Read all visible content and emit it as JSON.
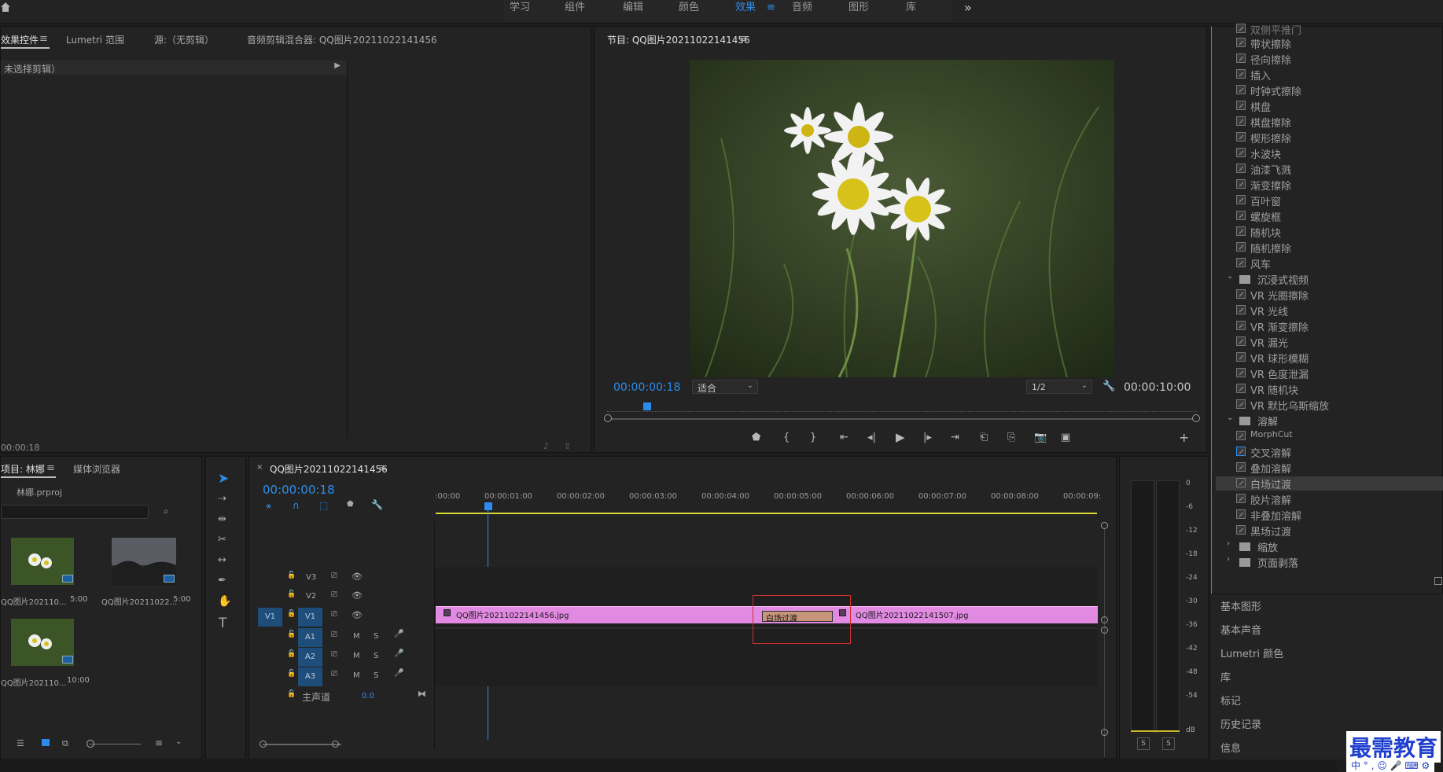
{
  "workspace_tabs": [
    "学习",
    "组件",
    "编辑",
    "颜色",
    "效果",
    "音频",
    "图形",
    "库"
  ],
  "more_symbol": "»",
  "home_icon": "home-icon",
  "effect_controls": {
    "tabs": [
      "效果控件",
      "Lumetri 范围",
      "源:（无剪辑）",
      "音频剪辑混合器: QQ图片20211022141456"
    ],
    "no_clip": "未选择剪辑）",
    "timecode": "00:00:18"
  },
  "program": {
    "title": "节目: QQ图片20211022141456",
    "timecode": "00:00:00:18",
    "fit": "适合",
    "resolution": "1/2",
    "duration": "00:00:10:00"
  },
  "project": {
    "tabs": [
      "项目: 林娜",
      "媒体浏览器"
    ],
    "file": "林娜.prproj",
    "items": [
      {
        "name": "QQ图片202110...",
        "duration": "5:00"
      },
      {
        "name": "QQ图片20211022...",
        "duration": "5:00"
      },
      {
        "name": "QQ图片202110...",
        "duration": "10:00"
      }
    ]
  },
  "timeline": {
    "title": "QQ图片20211022141456",
    "timecode": "00:00:00:18",
    "ruler": [
      ":00:00",
      "00:00:01:00",
      "00:00:02:00",
      "00:00:03:00",
      "00:00:04:00",
      "00:00:05:00",
      "00:00:06:00",
      "00:00:07:00",
      "00:00:08:00",
      "00:00:09:"
    ],
    "video_tracks": [
      "V3",
      "V2",
      "V1"
    ],
    "audio_tracks": [
      "A1",
      "A2",
      "A3"
    ],
    "source_patch": "V1",
    "master_label": "主声道",
    "master_value": "0.0",
    "clip1": "QQ图片20211022141456.jpg",
    "clip2": "QQ图片20211022141507.jpg",
    "transition": "白场过渡",
    "track_m": "M",
    "track_s": "S"
  },
  "meter": {
    "ticks": [
      "0",
      "-6",
      "-12",
      "-18",
      "-24",
      "-30",
      "-36",
      "-42",
      "-48",
      "-54",
      "dB"
    ],
    "solo": [
      "S",
      "S"
    ]
  },
  "effects": {
    "items_top": [
      "双侧平推门",
      "带状擦除",
      "径向擦除",
      "插入",
      "时钟式擦除",
      "棋盘",
      "棋盘擦除",
      "楔形擦除",
      "水波块",
      "油漆飞溅",
      "渐变擦除",
      "百叶窗",
      "螺旋框",
      "随机块",
      "随机擦除",
      "风车"
    ],
    "folder_immersive": "沉浸式视频",
    "items_vr": [
      "VR 光圈擦除",
      "VR 光线",
      "VR 渐变擦除",
      "VR 漏光",
      "VR 球形模糊",
      "VR 色度泄漏",
      "VR 随机块",
      "VR 默比乌斯缩放"
    ],
    "folder_dissolve": "溶解",
    "items_dissolve": [
      "MorphCut",
      "交叉溶解",
      "叠加溶解",
      "白场过渡",
      "胶片溶解",
      "非叠加溶解",
      "黑场过渡"
    ],
    "folder_zoom": "缩放",
    "folder_pagepeel": "页面剥落",
    "selected": "白场过渡"
  },
  "right_panels": [
    "基本图形",
    "基本声音",
    "Lumetri 颜色",
    "库",
    "标记",
    "历史记录",
    "信息"
  ],
  "watermark": "最需教育",
  "watermark_sub": "中 ° , ☺ 🎤 ⌨ ⚙",
  "colors": {
    "accent": "#2d8ceb",
    "clip": "#e28ae2",
    "transition": "#c7957a",
    "bg": "#1d1d1d"
  }
}
